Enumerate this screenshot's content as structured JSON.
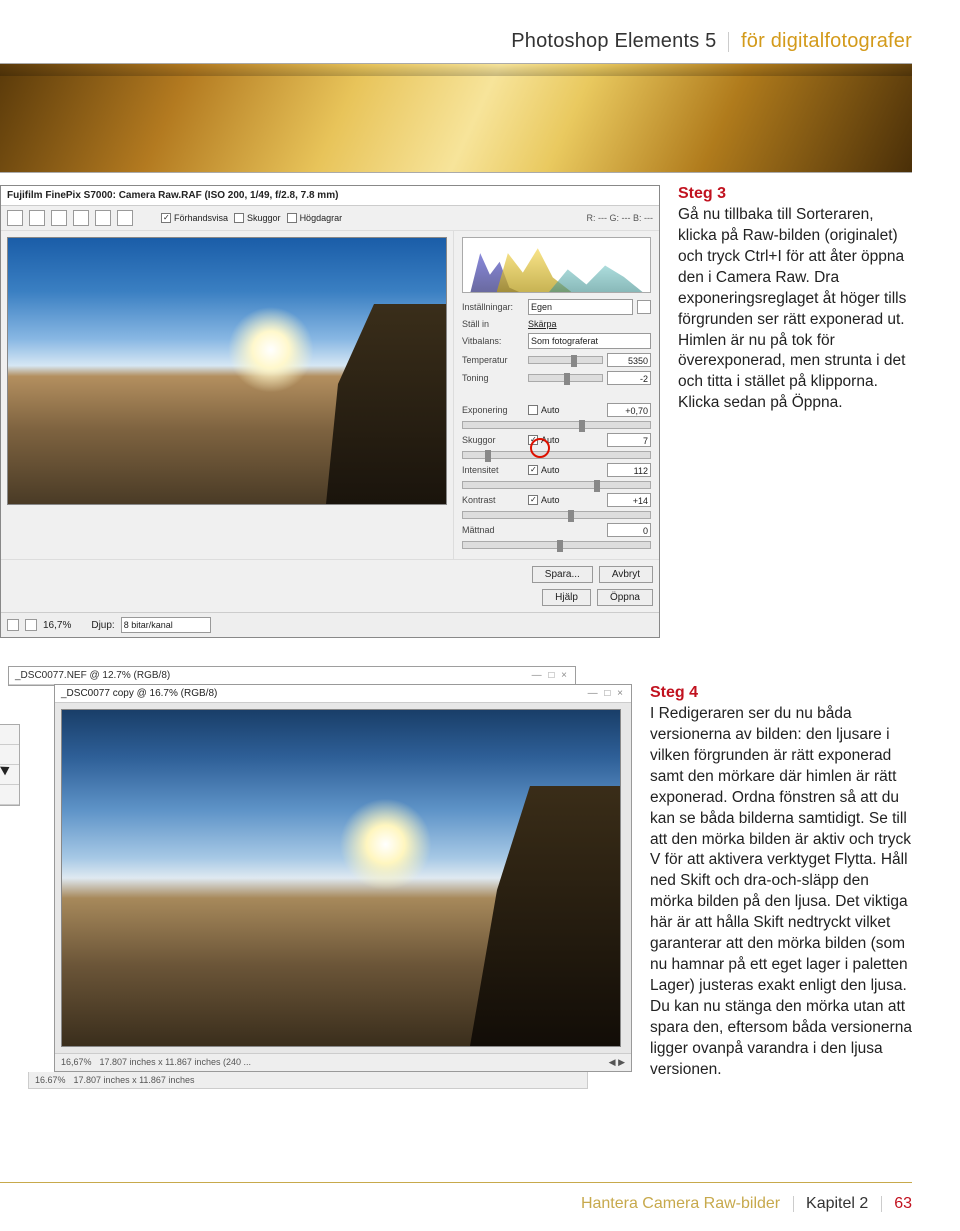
{
  "header": {
    "title_left": "Photoshop Elements 5",
    "title_right": "för digitalfotografer"
  },
  "camera_raw": {
    "title": "Fujifilm FinePix S7000: Camera Raw.RAF (ISO 200, 1/49, f/2.8, 7.8 mm)",
    "checkboxes": {
      "preview": "Förhandsvisa",
      "shadows": "Skuggor",
      "highlights": "Högdagrar"
    },
    "rgb": "R: ---   G: ---   B: ---",
    "settings_label": "Inställningar:",
    "settings_value": "Egen",
    "setin_label": "Ställ in",
    "setin_value": "Skärpa",
    "whitebalance_label": "Vitbalans:",
    "whitebalance_value": "Som fotograferat",
    "sliders": [
      {
        "label": "Temperatur",
        "value": "5350"
      },
      {
        "label": "Toning",
        "value": "-2"
      }
    ],
    "adjust": [
      {
        "label": "Exponering",
        "auto": "Auto",
        "value": "+0,70"
      },
      {
        "label": "Skuggor",
        "auto": "Auto",
        "value": "7"
      },
      {
        "label": "Intensitet",
        "auto": "Auto",
        "value": "112"
      },
      {
        "label": "Kontrast",
        "auto": "Auto",
        "value": "+14"
      },
      {
        "label": "Mättnad",
        "auto": "",
        "value": "0"
      }
    ],
    "buttons": {
      "save": "Spara...",
      "cancel": "Avbryt",
      "help": "Hjälp",
      "open": "Öppna"
    },
    "bottom": {
      "zoom": "16,7%",
      "depth_label": "Djup:",
      "depth_value": "8 bitar/kanal"
    }
  },
  "step3": {
    "title": "Steg 3",
    "body": "Gå nu tillbaka till Sorteraren, klicka på Raw-bilden (originalet) och tryck Ctrl+I för att åter öppna den i Camera Raw. Dra exponeringsreglaget åt höger tills förgrunden ser rätt exponerad ut. Himlen är nu på tok för överexponerad, men strunta i det och titta i stället på klipporna. Klicka sedan på Öppna."
  },
  "editor": {
    "back_title": "_DSC0077.NEF @ 12.7% (RGB/8)",
    "front_title": "_DSC0077 copy @ 16.7% (RGB/8)",
    "status": {
      "zoom": "16,67%",
      "dims": "17.807 inches x 11.867 inches (240 ...",
      "zoom_back": "16.67%",
      "dims_back": "17.807 inches x 11.867 inches"
    }
  },
  "step4": {
    "title": "Steg 4",
    "body": "I Redigeraren ser du nu båda versionerna av bilden: den ljusare i vilken förgrunden är rätt exponerad samt den mörkare där himlen är rätt exponerad. Ordna fönstren så att du kan se båda bilderna samtidigt. Se till att den mörka bilden är aktiv och tryck V för att aktivera verktyget Flytta. Håll ned Skift och dra-och-släpp den mörka bilden på den ljusa. Det viktiga här är att hålla Skift nedtryckt vilket garanterar att den mörka bilden (som nu hamnar på ett eget lager i paletten Lager) justeras exakt enligt den ljusa. Du kan nu stänga den mörka utan att spara den, eftersom båda versionerna ligger ovanpå varandra i den ljusa versionen."
  },
  "footer": {
    "section": "Hantera Camera Raw-bilder",
    "chapter": "Kapitel 2",
    "page": "63"
  }
}
